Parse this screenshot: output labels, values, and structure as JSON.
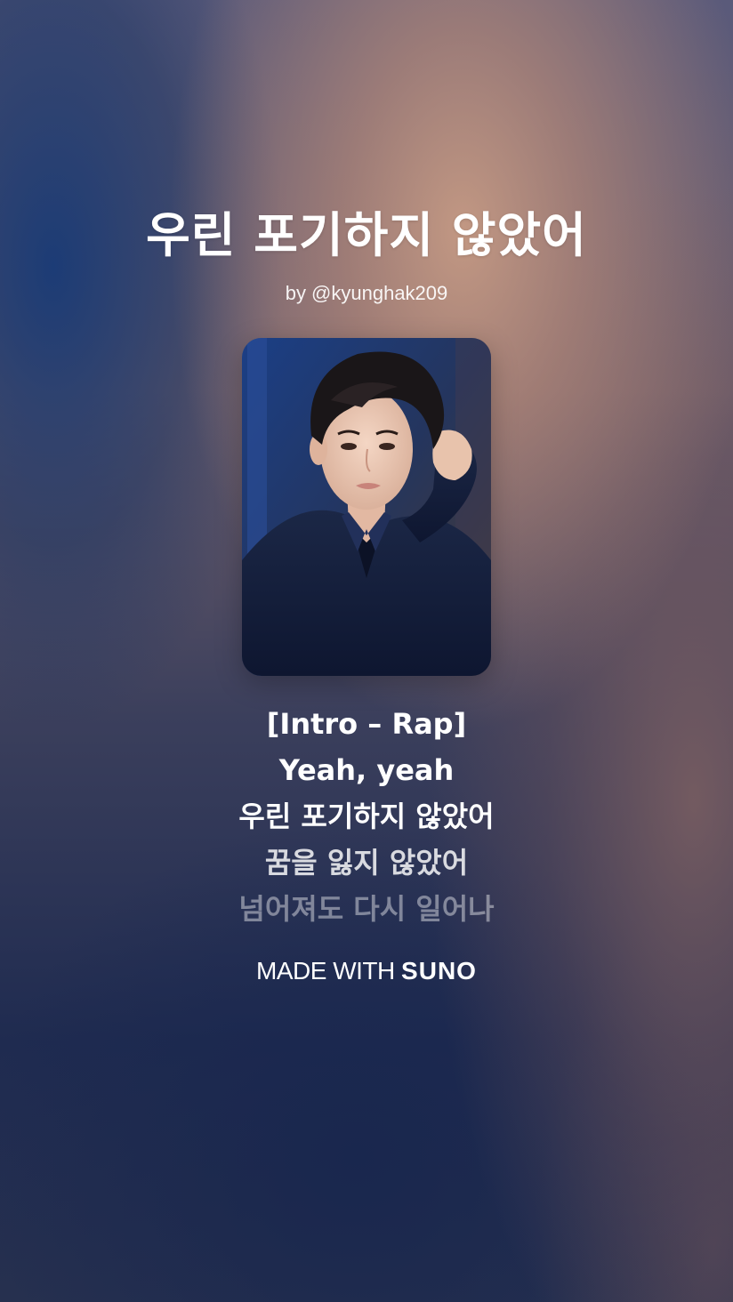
{
  "song": {
    "title": "우린 포기하지 않았어",
    "byline": "by @kyunghak209"
  },
  "lyrics": [
    "[Intro – Rap]",
    "Yeah, yeah",
    "우린 포기하지 않았어",
    "꿈을 잃지 않았어",
    "넘어져도 다시 일어나"
  ],
  "footer": {
    "made_with_label": "MADE WITH",
    "brand": "SUNO"
  },
  "colors": {
    "text": "#ffffff",
    "bg_warm": "#c79b84",
    "bg_navy": "#1f2b50"
  }
}
